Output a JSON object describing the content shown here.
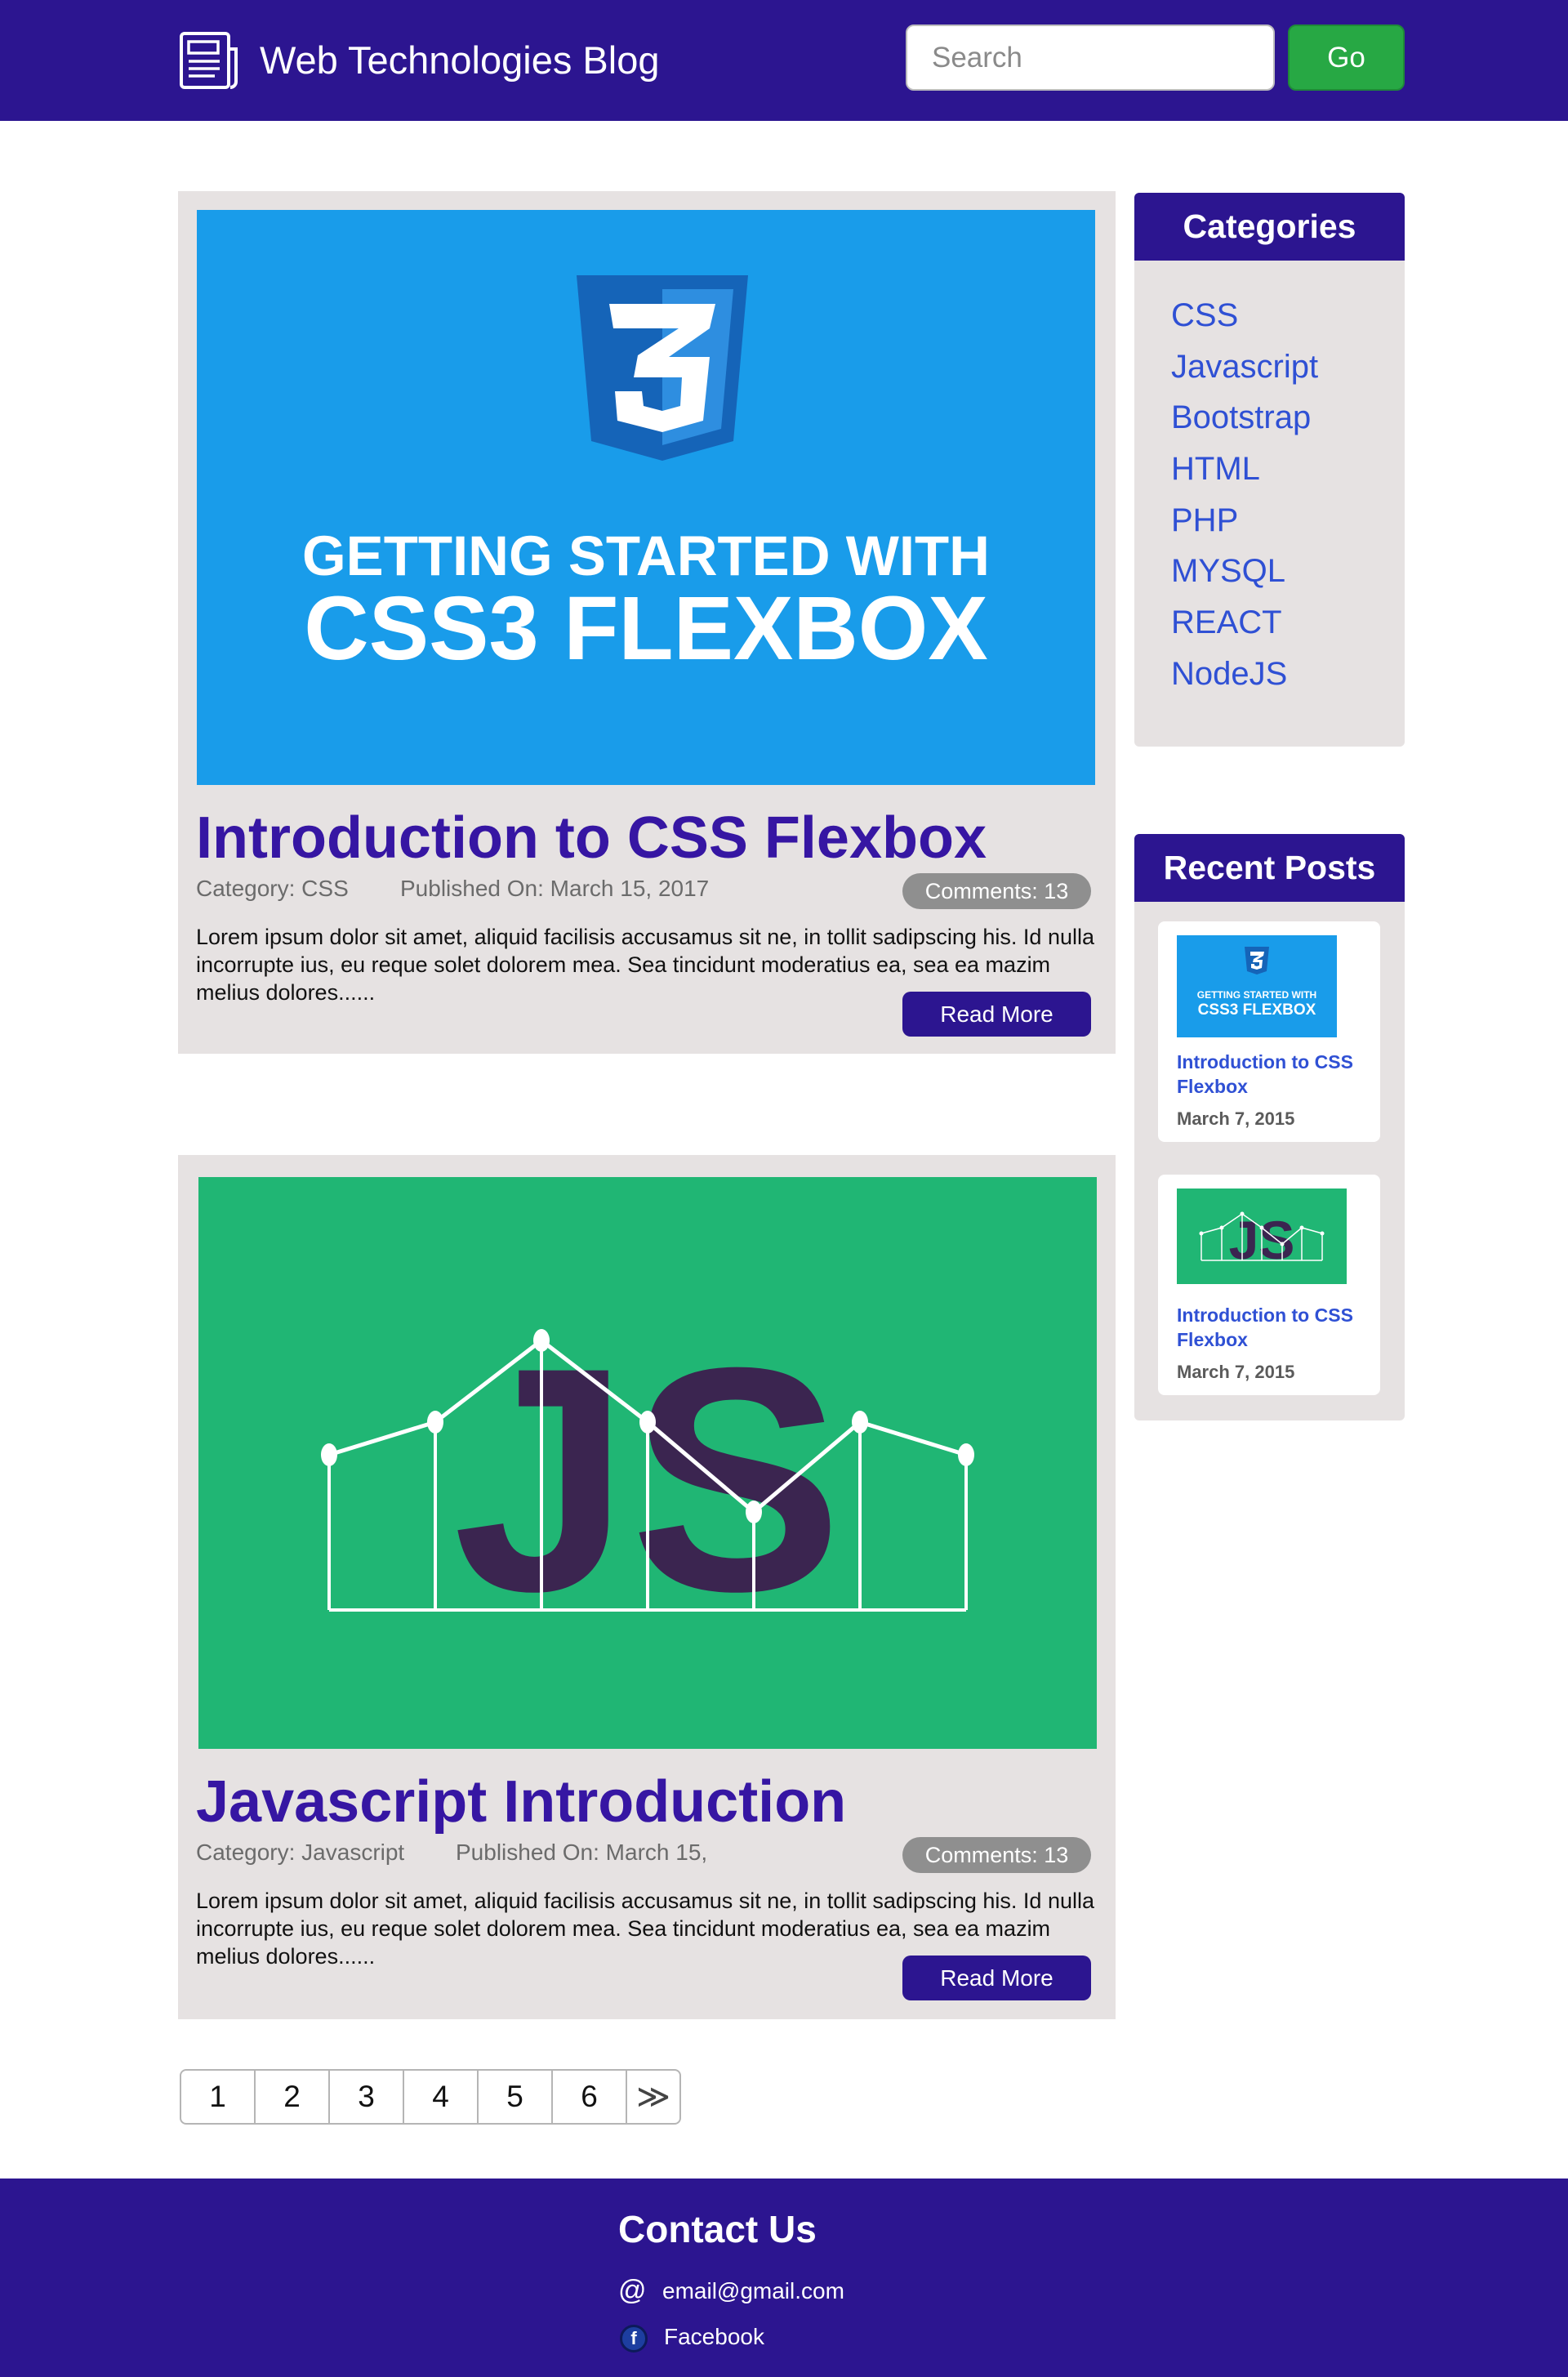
{
  "header": {
    "site_title": "Web Technologies Blog",
    "search_placeholder": "Search",
    "go_label": "Go",
    "logo_icon": "newspaper-icon"
  },
  "posts": [
    {
      "image": {
        "line1": "GETTING STARTED WITH",
        "line2": "CSS3 FLEXBOX",
        "icon": "css3-shield-icon",
        "background": "#199cea"
      },
      "title": "Introduction to CSS Flexbox",
      "category": "Category: CSS",
      "published": "Published On: March 15, 2017",
      "comments": "Comments: 13",
      "excerpt": "Lorem ipsum dolor sit amet, aliquid facilisis accusamus sit ne, in tollit sadipscing his. Id nulla incorrupte ius, eu reque solet dolorem mea. Sea tincidunt moderatius ea, sea ea mazim melius dolores......",
      "read_more": "Read More"
    },
    {
      "image": {
        "text": "JS",
        "icon": "js-line-chart-icon",
        "background": "#20b674"
      },
      "title": "Javascript Introduction",
      "category": "Category: Javascript",
      "published": "Published On: March 15,",
      "comments": "Comments: 13",
      "excerpt": "Lorem ipsum dolor sit amet, aliquid facilisis accusamus sit ne, in tollit sadipscing his. Id nulla incorrupte ius, eu reque solet dolorem mea. Sea tincidunt moderatius ea, sea ea mazim melius dolores......",
      "read_more": "Read More"
    }
  ],
  "sidebar": {
    "categories_heading": "Categories",
    "categories": [
      "CSS",
      "Javascript",
      "Bootstrap",
      "HTML",
      "PHP",
      "MYSQL",
      "REACT",
      "NodeJS"
    ],
    "recent_heading": "Recent Posts",
    "recent_posts": [
      {
        "title": "Introduction to CSS Flexbox",
        "date": "March 7, 2015",
        "thumb_line1": "GETTING STARTED WITH",
        "thumb_line2": "CSS3 FLEXBOX"
      },
      {
        "title": "Introduction to CSS Flexbox",
        "date": "March 7, 2015",
        "thumb_text": "JS"
      }
    ]
  },
  "pagination": {
    "pages": [
      "1",
      "2",
      "3",
      "4",
      "5",
      "6"
    ],
    "next_icon": "double-chevron-right-icon",
    "next_label": "≫"
  },
  "footer": {
    "title": "Contact Us",
    "email": "email@gmail.com",
    "email_icon": "@",
    "facebook": "Facebook",
    "facebook_icon": "f"
  },
  "colors": {
    "brand": "#2c1590",
    "accent_link": "#2f50d4",
    "go_green": "#27a844",
    "panel_bg": "#e6e2e2"
  }
}
